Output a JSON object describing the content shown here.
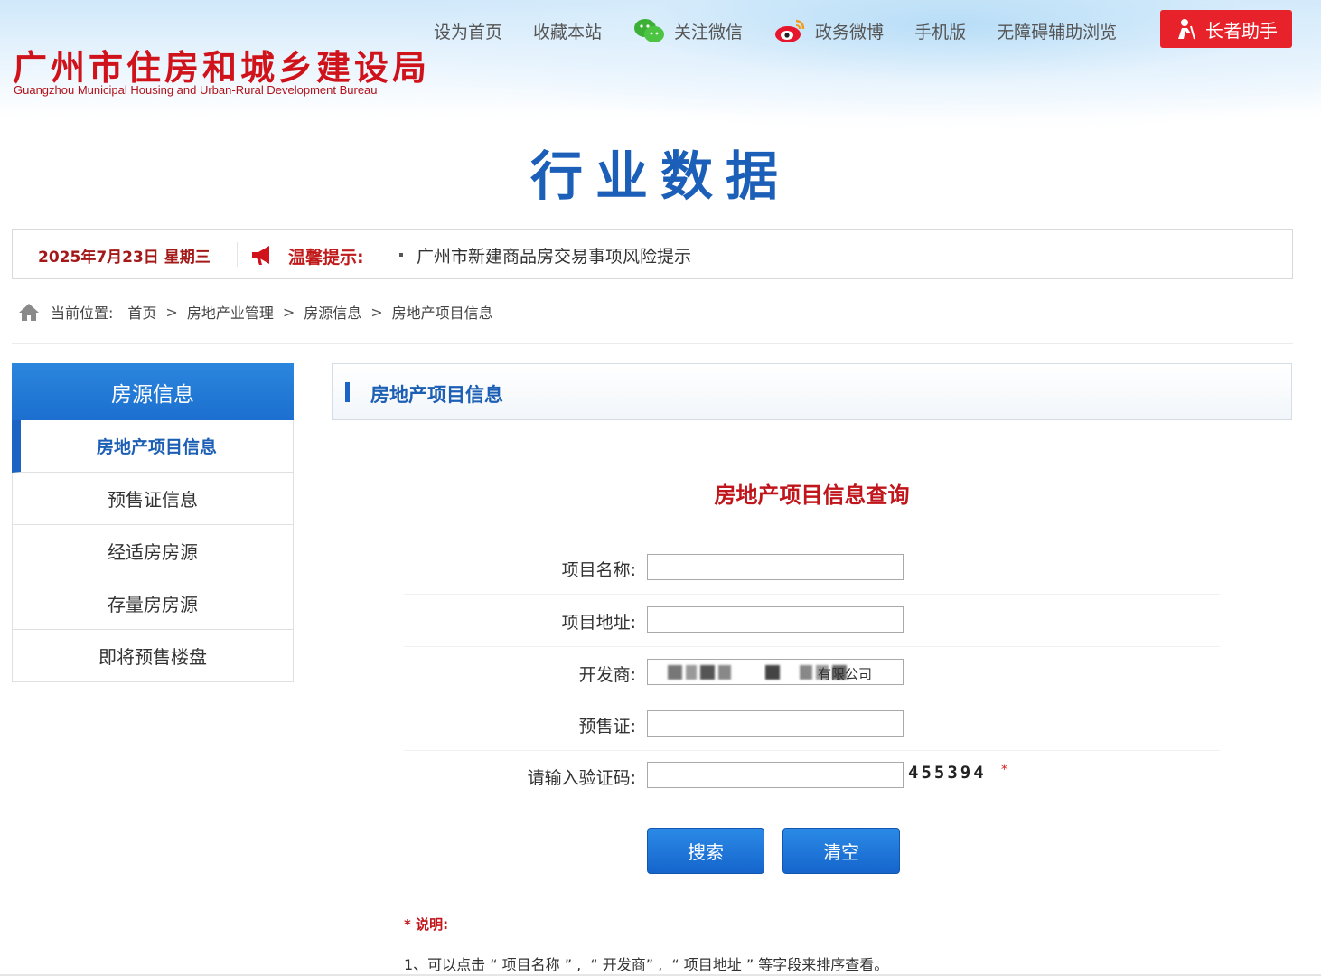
{
  "header": {
    "logo_cn": "广州市住房和城乡建设局",
    "logo_en": "Guangzhou Municipal Housing and Urban-Rural Development Bureau",
    "nav": [
      {
        "label": "设为首页"
      },
      {
        "label": "收藏本站"
      },
      {
        "label": "关注微信",
        "icon": "wechat-icon"
      },
      {
        "label": "政务微博",
        "icon": "weibo-icon"
      },
      {
        "label": "手机版"
      },
      {
        "label": "无障碍辅助浏览"
      }
    ],
    "elder_button": "长者助手",
    "page_title": "行业数据"
  },
  "notice": {
    "date": "2025年7月23日 星期三",
    "label": "温馨提示:",
    "text": "广州市新建商品房交易事项风险提示"
  },
  "breadcrumb": {
    "prefix": "当前位置:",
    "items": [
      "首页",
      "房地产业管理",
      "房源信息",
      "房地产项目信息"
    ],
    "separator": ">"
  },
  "sidebar": {
    "title": "房源信息",
    "items": [
      {
        "label": "房地产项目信息",
        "active": true
      },
      {
        "label": "预售证信息"
      },
      {
        "label": "经适房房源"
      },
      {
        "label": "存量房房源"
      },
      {
        "label": "即将预售楼盘"
      }
    ]
  },
  "panel": {
    "title": "房地产项目信息"
  },
  "form": {
    "title": "房地产项目信息查询",
    "fields": [
      {
        "label": "项目名称:",
        "value": ""
      },
      {
        "label": "项目地址:",
        "value": ""
      },
      {
        "label": "开发商:",
        "value": "有限公司"
      },
      {
        "label": "预售证:",
        "value": ""
      },
      {
        "label": "请输入验证码:",
        "value": ""
      }
    ],
    "captcha": "455394",
    "required_mark": "*",
    "search_button": "搜索",
    "clear_button": "清空"
  },
  "notes": {
    "title": "* 说明:",
    "line1": "1、可以点击 “ 项目名称 ” ,  “ 开发商” ,  “ 项目地址 ” 等字段来排序查看。"
  },
  "colors": {
    "brand_red": "#d0121b",
    "primary_blue": "#1b64c6",
    "title_blue": "#1b5fb8"
  }
}
